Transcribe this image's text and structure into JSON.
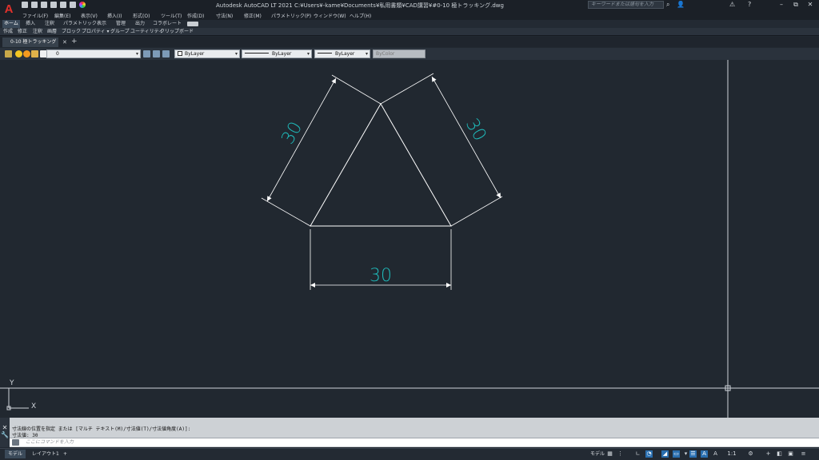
{
  "app": {
    "logo": "A",
    "title": "Autodesk AutoCAD LT 2021    C:¥Users¥-kame¥Documents¥私用書類¥CAD講習¥#0-10 極トラッキング.dwg",
    "search_placeholder": "キーワードまたは語句を入力",
    "window_controls": {
      "minimize": "–",
      "restore": "⧉",
      "close": "✕"
    }
  },
  "menu": [
    "ファイル(F)",
    "編集(E)",
    "表示(V)",
    "挿入(I)",
    "形式(O)",
    "ツール(T)",
    "作成(D)",
    "寸法(N)",
    "修正(M)",
    "パラメトリック(P)",
    "ウィンドウ(W)",
    "ヘルプ(H)"
  ],
  "ribbon_tabs": [
    "ホーム",
    "挿入",
    "注釈",
    "パラメトリック",
    "表示",
    "管理",
    "出力",
    "コラボレート"
  ],
  "ribbon_panels": [
    "作成",
    "修正",
    "注釈",
    "画層",
    "ブロック",
    "プロパティ ▾",
    "グループ",
    "ユーティリティ",
    "クリップボード"
  ],
  "file_tab": {
    "label": "0-10 極トラッキング*",
    "new_tab": "+"
  },
  "properties": {
    "layer_name": "0",
    "color": "ByLayer",
    "linetype": "ByLayer",
    "lineweight": "ByLayer",
    "plotstyle": "ByColor"
  },
  "drawing": {
    "dimensions": [
      {
        "label": "30",
        "side": "left"
      },
      {
        "label": "30",
        "side": "right"
      },
      {
        "label": "30",
        "side": "bottom"
      }
    ],
    "ucs": {
      "x_label": "X",
      "y_label": "Y"
    },
    "colors": {
      "background": "#212830",
      "geometry": "#ffffff",
      "dimension_text": "#1fb8b8"
    }
  },
  "command": {
    "history_1": "寸法線の位置を指定 または [マルチ テキスト(M)/寸法値(T)/寸法値角度(A)]:",
    "history_2": "寸法値: 30",
    "input_placeholder": "ここにコマンドを入力"
  },
  "status": {
    "tabs": [
      "モデル",
      "レイアウト1"
    ],
    "add_layout": "+",
    "model_label": "モデル",
    "scale": "1:1"
  }
}
